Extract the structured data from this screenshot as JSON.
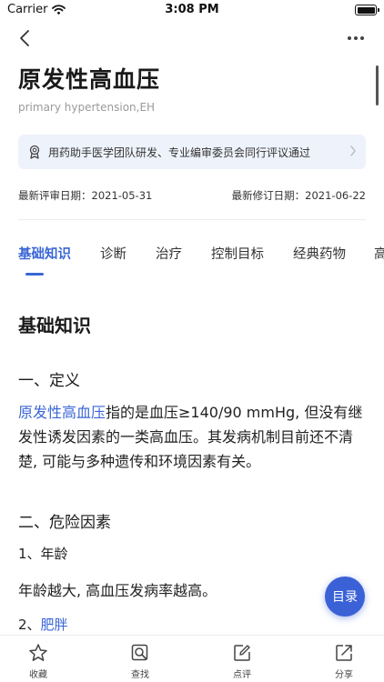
{
  "status_bar": {
    "carrier": "Carrier",
    "time": "3:08 PM"
  },
  "nav": {
    "back_icon": "chevron-left-icon",
    "more_icon": "ellipsis-icon"
  },
  "article": {
    "title": "原发性高血压",
    "subtitle": "primary hypertension,EH",
    "review_banner": "用药助手医学团队研发、专业编审委员会同行评议通过",
    "review_date_label": "最新评审日期：",
    "review_date": "2021-05-31",
    "revise_date_label": "最新修订日期：",
    "revise_date": "2021-06-22"
  },
  "tabs": [
    {
      "label": "基础知识",
      "active": true
    },
    {
      "label": "诊断",
      "active": false
    },
    {
      "label": "治疗",
      "active": false
    },
    {
      "label": "控制目标",
      "active": false
    },
    {
      "label": "经典药物",
      "active": false
    },
    {
      "label": "高",
      "active": false
    }
  ],
  "content": {
    "heading": "基础知识",
    "section1_title": "一、定义",
    "def_link": "原发性高血压",
    "def_text": "指的是血压≥140/90 mmHg, 但没有继发性诱发因素的一类高血压。其发病机制目前还不清楚, 可能与多种遗传和环境因素有关。",
    "section2_title": "二、危险因素",
    "item1_title": "1、年龄",
    "item1_text": "年龄越大, 高血压发病率越高。",
    "item2_prefix": "2、",
    "item2_link": "肥胖"
  },
  "toc_button": "目录",
  "bottom_bar": [
    {
      "label": "收藏",
      "icon": "star-icon"
    },
    {
      "label": "查找",
      "icon": "search-icon"
    },
    {
      "label": "点评",
      "icon": "edit-icon"
    },
    {
      "label": "分享",
      "icon": "share-icon"
    }
  ],
  "colors": {
    "accent": "#3a66d6",
    "banner_bg": "#eef2fb"
  }
}
